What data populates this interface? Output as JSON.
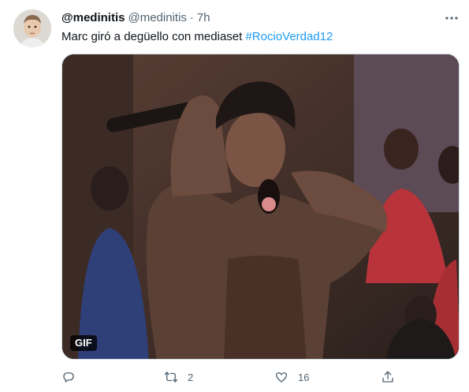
{
  "tweet": {
    "display_name": "@medinitis",
    "handle": "@medinitis",
    "separator": "·",
    "time": "7h",
    "text_prefix": "Marc giró a degüello con mediaset ",
    "hashtag": "#RocioVerdad12",
    "media_badge": "GIF",
    "retweet_count": "2",
    "like_count": "16"
  },
  "icons": {
    "more": "more-horizontal-icon",
    "reply": "reply-icon",
    "retweet": "retweet-icon",
    "like": "heart-icon",
    "share": "share-icon"
  },
  "colors": {
    "link": "#1d9bf0",
    "secondary_text": "#536471"
  }
}
